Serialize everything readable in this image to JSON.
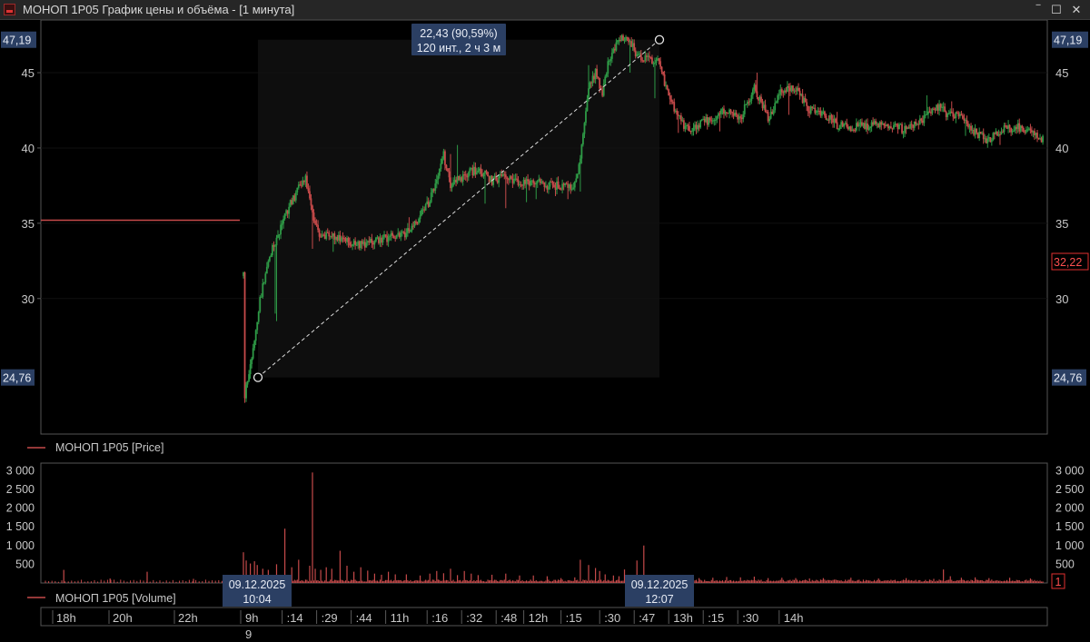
{
  "window": {
    "title": "МОНОП 1Р05 График цены и объёма - [1 минута]",
    "controls": [
      "‾",
      "☐",
      "✕"
    ]
  },
  "colors": {
    "up": "#2e9a46",
    "down": "#c64a4a",
    "badge": "#2b3f63",
    "axis": "#5a5a5a",
    "last_price": "#e03030"
  },
  "chart_data": {
    "type": "candlestick",
    "price": {
      "ylim": [
        21,
        48.5
      ],
      "y_ticks": [
        30,
        35,
        40,
        45
      ],
      "prev_session_level": 35.2,
      "start_level": 24.76,
      "end_level": 47.19,
      "last_price": "32,22",
      "left_badges": [
        "47,19",
        "24,76"
      ],
      "right_badges": [
        "47,19",
        "24,76"
      ],
      "measure_label_line1": "22,43 (90,59%)",
      "measure_label_line2": "120 инт., 2 ч 3 м",
      "legend": "МОНОП 1Р05 [Price]",
      "path": [
        [
          0,
          31.5
        ],
        [
          1,
          23.5
        ],
        [
          5,
          25.5
        ],
        [
          12,
          30
        ],
        [
          20,
          33
        ],
        [
          30,
          35.5
        ],
        [
          38,
          37
        ],
        [
          45,
          38
        ],
        [
          50,
          35.5
        ],
        [
          55,
          34
        ],
        [
          60,
          34.2
        ],
        [
          70,
          34
        ],
        [
          80,
          33.6
        ],
        [
          90,
          33.6
        ],
        [
          100,
          34
        ],
        [
          115,
          34.2
        ],
        [
          125,
          35
        ],
        [
          135,
          36.5
        ],
        [
          145,
          39.5
        ],
        [
          150,
          37.5
        ],
        [
          160,
          38.2
        ],
        [
          170,
          38.6
        ],
        [
          180,
          37.8
        ],
        [
          190,
          38.2
        ],
        [
          200,
          37.5
        ],
        [
          210,
          37.8
        ],
        [
          220,
          37.5
        ],
        [
          230,
          37.5
        ],
        [
          240,
          37.5
        ],
        [
          245,
          40
        ],
        [
          250,
          44
        ],
        [
          255,
          45
        ],
        [
          260,
          43.5
        ],
        [
          265,
          46
        ],
        [
          272,
          47.2
        ],
        [
          278,
          47.4
        ],
        [
          285,
          46.2
        ],
        [
          290,
          46
        ],
        [
          300,
          45.8
        ],
        [
          310,
          43
        ],
        [
          320,
          41.2
        ],
        [
          330,
          41.5
        ],
        [
          340,
          42
        ],
        [
          350,
          42.5
        ],
        [
          360,
          42
        ],
        [
          370,
          44
        ],
        [
          380,
          42
        ],
        [
          390,
          43.8
        ],
        [
          400,
          44
        ],
        [
          410,
          42.5
        ],
        [
          420,
          42.3
        ],
        [
          430,
          41.5
        ],
        [
          440,
          41.3
        ],
        [
          450,
          41.5
        ],
        [
          460,
          41.5
        ],
        [
          470,
          41.5
        ],
        [
          480,
          41.2
        ],
        [
          490,
          41.8
        ],
        [
          500,
          42.5
        ],
        [
          505,
          42.8
        ],
        [
          510,
          42.2
        ],
        [
          520,
          42.1
        ],
        [
          530,
          41
        ],
        [
          540,
          40.5
        ],
        [
          550,
          41.2
        ],
        [
          560,
          41.4
        ],
        [
          570,
          41.2
        ],
        [
          579,
          40.6
        ]
      ],
      "spikes": [
        [
          23,
          29
        ],
        [
          24,
          28.5
        ],
        [
          48,
          37.5
        ],
        [
          50,
          33.3
        ],
        [
          65,
          33.1
        ],
        [
          120,
          35.4
        ],
        [
          150,
          39.6
        ],
        [
          155,
          40.2
        ],
        [
          170,
          38.5
        ],
        [
          175,
          36.3
        ],
        [
          190,
          36
        ],
        [
          205,
          36.4
        ],
        [
          212,
          36.6
        ],
        [
          226,
          36.8
        ],
        [
          235,
          36.6
        ],
        [
          244,
          37.1
        ],
        [
          250,
          45.5
        ],
        [
          280,
          45
        ],
        [
          298,
          43.3
        ],
        [
          315,
          41
        ],
        [
          345,
          41.1
        ],
        [
          372,
          45
        ],
        [
          376,
          42.5
        ],
        [
          395,
          42.2
        ],
        [
          430,
          42.4
        ],
        [
          495,
          43.5
        ],
        [
          513,
          43.1
        ],
        [
          523,
          40.8
        ],
        [
          548,
          40.2
        ]
      ]
    },
    "volume": {
      "ylim": [
        0,
        3200
      ],
      "y_ticks": [
        "3 000",
        "2 500",
        "2 000",
        "1 500",
        "1 000",
        "500"
      ],
      "y_values": [
        3000,
        2500,
        2000,
        1500,
        1000,
        500
      ],
      "last_value": "1",
      "legend": "МОНОП 1Р05 [Volume]",
      "baseline": 60,
      "prev_session_bars": [
        [
          3,
          350
        ],
        [
          18,
          120
        ],
        [
          30,
          300
        ],
        [
          45,
          110
        ],
        [
          60,
          90
        ]
      ],
      "bars": [
        [
          0,
          820
        ],
        [
          2,
          600
        ],
        [
          5,
          520
        ],
        [
          8,
          580
        ],
        [
          10,
          480
        ],
        [
          14,
          380
        ],
        [
          18,
          350
        ],
        [
          24,
          500
        ],
        [
          30,
          1450
        ],
        [
          35,
          420
        ],
        [
          40,
          620
        ],
        [
          48,
          460
        ],
        [
          50,
          2950
        ],
        [
          52,
          380
        ],
        [
          56,
          350
        ],
        [
          60,
          420
        ],
        [
          64,
          380
        ],
        [
          70,
          860
        ],
        [
          75,
          460
        ],
        [
          80,
          300
        ],
        [
          85,
          420
        ],
        [
          90,
          330
        ],
        [
          95,
          250
        ],
        [
          100,
          220
        ],
        [
          105,
          300
        ],
        [
          110,
          230
        ],
        [
          118,
          230
        ],
        [
          128,
          200
        ],
        [
          135,
          250
        ],
        [
          140,
          320
        ],
        [
          145,
          260
        ],
        [
          150,
          380
        ],
        [
          155,
          210
        ],
        [
          160,
          320
        ],
        [
          165,
          250
        ],
        [
          170,
          210
        ],
        [
          180,
          220
        ],
        [
          190,
          250
        ],
        [
          200,
          200
        ],
        [
          210,
          200
        ],
        [
          220,
          180
        ],
        [
          230,
          130
        ],
        [
          240,
          150
        ],
        [
          244,
          620
        ],
        [
          250,
          480
        ],
        [
          255,
          400
        ],
        [
          258,
          320
        ],
        [
          262,
          230
        ],
        [
          268,
          200
        ],
        [
          272,
          180
        ],
        [
          276,
          360
        ],
        [
          285,
          600
        ],
        [
          290,
          1000
        ],
        [
          295,
          150
        ],
        [
          300,
          130
        ],
        [
          310,
          140
        ],
        [
          320,
          130
        ],
        [
          330,
          130
        ],
        [
          340,
          140
        ],
        [
          350,
          160
        ],
        [
          360,
          150
        ],
        [
          370,
          170
        ],
        [
          380,
          130
        ],
        [
          390,
          140
        ],
        [
          400,
          130
        ],
        [
          410,
          120
        ],
        [
          420,
          130
        ],
        [
          440,
          140
        ],
        [
          460,
          120
        ],
        [
          480,
          130
        ],
        [
          500,
          110
        ],
        [
          507,
          360
        ],
        [
          512,
          180
        ],
        [
          520,
          140
        ],
        [
          530,
          150
        ],
        [
          540,
          130
        ],
        [
          555,
          140
        ],
        [
          570,
          120
        ]
      ]
    },
    "x_axis": {
      "prev_labels": [
        "18h",
        "20h",
        "22h"
      ],
      "labels": [
        "9h",
        ":14",
        ":29",
        ":44",
        "11h",
        ":16",
        ":32",
        ":48",
        "12h",
        ":15",
        ":30",
        ":47",
        "13h",
        ":15",
        ":30",
        "14h"
      ],
      "label_bars": [
        0,
        30,
        55,
        80,
        105,
        135,
        160,
        185,
        205,
        232,
        260,
        285,
        310,
        335,
        360,
        390
      ],
      "date_row": "9",
      "start_badge_line1": "09.12.2025",
      "start_badge_line2": "10:04",
      "end_badge_line1": "09.12.2025",
      "end_badge_line2": "12:07"
    }
  }
}
